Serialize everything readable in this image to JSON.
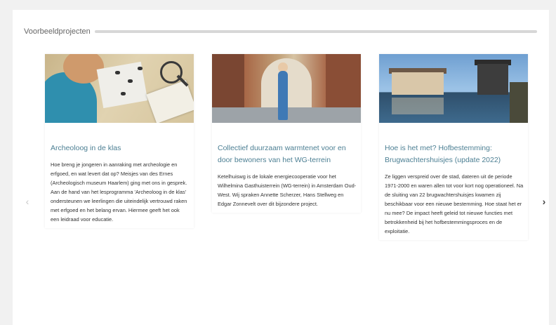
{
  "section": {
    "title": "Voorbeeldprojecten"
  },
  "carousel": {
    "prev_icon": "chevron-left-icon",
    "next_icon": "chevron-right-icon",
    "prev_glyph": "‹",
    "next_glyph": "›"
  },
  "cards": [
    {
      "title": "Archeoloog in de klas",
      "text": "Hoe breng je jongeren in aanraking met archeologie en erfgoed, en wat levert dat op? Meisjes van des Ernes (Archeologisch museum Haarlem) ging met ons in gesprek. Aan de hand van het lesprogramma 'Archeoloog in de klas' ondersteunen we leerlingen die uiteindelijk vertrouwd raken met erfgoed en het belang ervan. Hiermee geeft het ook een leidraad voor educatie."
    },
    {
      "title": "Collectief duurzaam warmtenet voor en door bewoners van het WG-terrein",
      "text": "Ketelhuiswg is de lokale energiecooperatie voor het Wilhelmina Gasthuisterrein (WG-terrein) in Amsterdam Oud-West. Wij spraken Annette Scherzer, Hans Stellweg en Edgar Zonnevelt over dit bijzondere project."
    },
    {
      "title": "Hoe is het met? Hofbestemming: Brugwachtershuisjes (update 2022)",
      "text": "Ze liggen verspreid over de stad, dateren uit de periode 1971-2000 en waren allen tot voor kort nog operationeel. Na de sluiting van 22 brugwachtershuisjes kwamen zij beschikbaar voor een nieuwe bestemming. Hoe staat het er nu mee? De impact heeft geleid tot nieuwe functies met betrokkenheid bij het hofbestemmingsproces en de exploitatie."
    }
  ]
}
